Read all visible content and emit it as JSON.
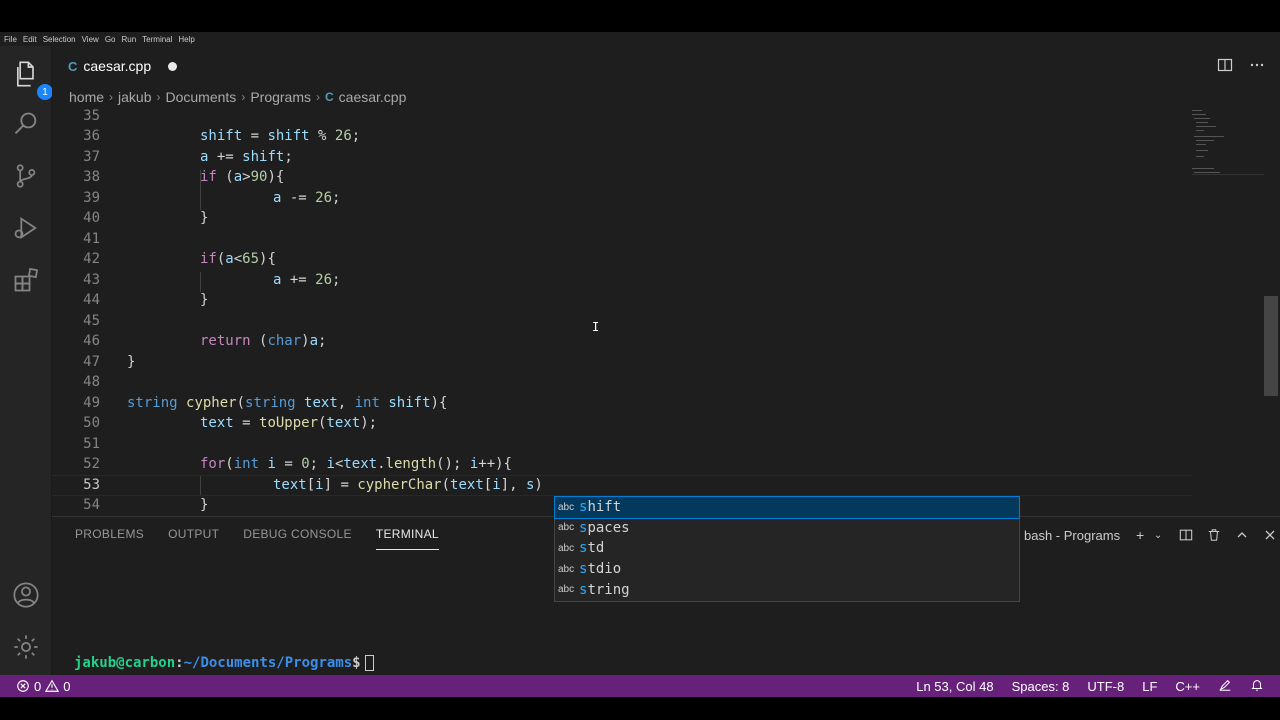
{
  "menu": [
    "File",
    "Edit",
    "Selection",
    "View",
    "Go",
    "Run",
    "Terminal",
    "Help"
  ],
  "activity": {
    "explorer_badge": "1",
    "icons": [
      "files-icon",
      "search-icon",
      "source-control-icon",
      "run-debug-icon",
      "extensions-icon",
      "account-icon",
      "gear-icon"
    ]
  },
  "tab": {
    "icon_text": "C",
    "label": "caesar.cpp",
    "modified": true
  },
  "breadcrumb": [
    "home",
    "jakub",
    "Documents",
    "Programs",
    "caesar.cpp"
  ],
  "editor": {
    "lines": [
      {
        "n": "35",
        "text": ""
      },
      {
        "n": "36",
        "text": "shift = shift % 26;"
      },
      {
        "n": "37",
        "text": "a += shift;"
      },
      {
        "n": "38",
        "text": "if (a>90){"
      },
      {
        "n": "39",
        "text": "a -= 26;"
      },
      {
        "n": "40",
        "text": "}"
      },
      {
        "n": "41",
        "text": ""
      },
      {
        "n": "42",
        "text": "if(a<65){"
      },
      {
        "n": "43",
        "text": "a += 26;"
      },
      {
        "n": "44",
        "text": "}"
      },
      {
        "n": "45",
        "text": ""
      },
      {
        "n": "46",
        "text": "return (char)a;"
      },
      {
        "n": "47",
        "text": "}"
      },
      {
        "n": "48",
        "text": ""
      },
      {
        "n": "49",
        "text": "string cypher(string text, int shift){"
      },
      {
        "n": "50",
        "text": "text = toUpper(text);"
      },
      {
        "n": "51",
        "text": ""
      },
      {
        "n": "52",
        "text": "for(int i = 0; i<text.length(); i++){"
      },
      {
        "n": "53",
        "text": "text[i] = cypherChar(text[i], s)"
      },
      {
        "n": "54",
        "text": "}"
      }
    ],
    "current_line": "53"
  },
  "suggestions": {
    "kind_label": "abc",
    "items": [
      {
        "prefix": "s",
        "rest": "hift"
      },
      {
        "prefix": "s",
        "rest": "paces"
      },
      {
        "prefix": "s",
        "rest": "td"
      },
      {
        "prefix": "s",
        "rest": "tdio"
      },
      {
        "prefix": "s",
        "rest": "tring"
      }
    ]
  },
  "panel": {
    "tabs": [
      "PROBLEMS",
      "OUTPUT",
      "DEBUG CONSOLE",
      "TERMINAL"
    ],
    "active_tab": "TERMINAL",
    "terminal_name": "bash - Programs",
    "prompt_user": "jakub@carbon",
    "prompt_sep": ":",
    "prompt_path": "~/Documents/Programs",
    "prompt_symbol": "$"
  },
  "status": {
    "errors": "0",
    "warnings": "0",
    "position": "Ln 53, Col 48",
    "spaces": "Spaces: 8",
    "encoding": "UTF-8",
    "eol": "LF",
    "language": "C++"
  },
  "colors": {
    "statusbar": "#68217a",
    "editor_bg": "#1e1e1e",
    "keyword": "#c586c0",
    "type": "#569cd6",
    "function": "#dcdcaa",
    "number": "#b5cea8"
  }
}
